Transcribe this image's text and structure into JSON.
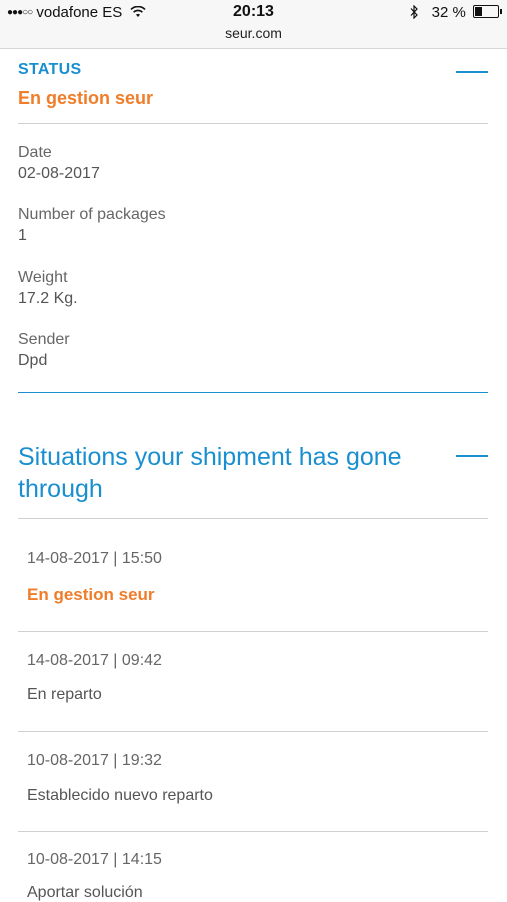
{
  "statusbar": {
    "signal": "●●●○○",
    "carrier": "vodafone ES",
    "time": "20:13",
    "url": "seur.com",
    "battery": "32 %",
    "battery_level": 0.32
  },
  "status": {
    "label": "STATUS",
    "value": "En gestion seur"
  },
  "details": [
    {
      "label": "Date",
      "value": "02-08-2017"
    },
    {
      "label": "Number of packages",
      "value": "1"
    },
    {
      "label": "Weight",
      "value": "17.2 Kg."
    },
    {
      "label": "Sender",
      "value": "Dpd"
    }
  ],
  "situations": {
    "title": "Situations your shipment has gone through",
    "entries": [
      {
        "datetime": "14-08-2017 | 15:50",
        "text": "En gestion seur"
      },
      {
        "datetime": "14-08-2017 | 09:42",
        "text": "En reparto"
      },
      {
        "datetime": "10-08-2017 | 19:32",
        "text": "Establecido nuevo reparto"
      },
      {
        "datetime": "10-08-2017 | 14:15",
        "text": "Aportar solución"
      }
    ]
  },
  "colors": {
    "accent": "#1a8fd0",
    "highlight": "#f07d2a"
  }
}
